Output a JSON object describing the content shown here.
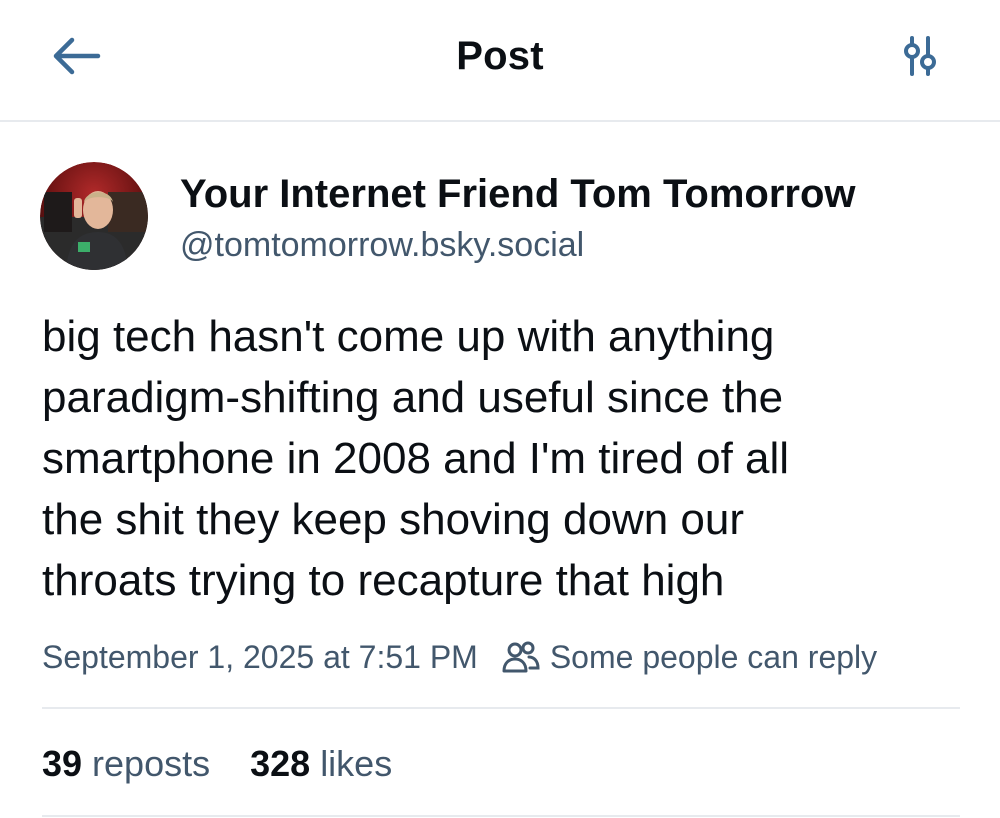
{
  "header": {
    "title": "Post",
    "back_icon": "arrow-left-icon",
    "settings_icon": "sliders-icon"
  },
  "author": {
    "display_name": "Your Internet Friend Tom Tomorrow",
    "handle": "@tomtomorrow.bsky.social",
    "avatar_icon": "avatar"
  },
  "post": {
    "lines": [
      "big tech hasn't come up with anything",
      "paradigm-shifting and useful since the",
      "smartphone in 2008 and I'm tired of all",
      "the shit they keep shoving down our",
      "throats trying to recapture that high"
    ]
  },
  "meta": {
    "timestamp": "September 1, 2025 at 7:51 PM",
    "reply_setting": "Some people can reply",
    "reply_icon": "people-icon"
  },
  "stats": {
    "reposts_count": "39",
    "reposts_label": "reposts",
    "likes_count": "328",
    "likes_label": "likes"
  },
  "colors": {
    "accent": "#1083fe",
    "text_primary": "#0b0f14",
    "text_secondary": "#42576c",
    "icon": "#3c6b96",
    "divider": "#e7eaee"
  }
}
